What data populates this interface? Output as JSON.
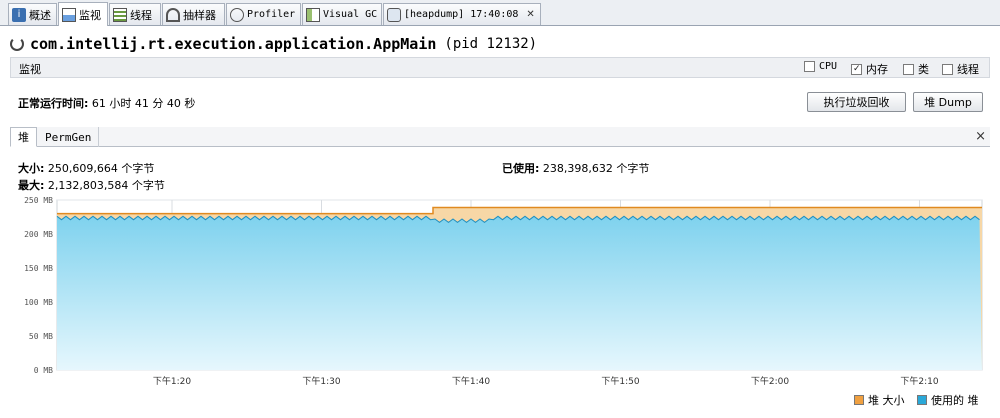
{
  "tabs": [
    {
      "label": "概述"
    },
    {
      "label": "监视"
    },
    {
      "label": "线程"
    },
    {
      "label": "抽样器"
    },
    {
      "label": "Profiler"
    },
    {
      "label": "Visual GC"
    },
    {
      "label": "[heapdump] 17:40:08"
    }
  ],
  "tab_close": "✕",
  "app": {
    "title": "com.intellij.rt.execution.application.AppMain",
    "pid": "(pid 12132)"
  },
  "section": {
    "label": "监视",
    "checkboxes": [
      {
        "label": "CPU",
        "checked": false
      },
      {
        "label": "内存",
        "checked": true
      },
      {
        "label": "类",
        "checked": false
      },
      {
        "label": "线程",
        "checked": false
      }
    ]
  },
  "uptime": {
    "label": "正常运行时间:",
    "value": "61 小时 41 分 40 秒"
  },
  "buttons": {
    "gc": "执行垃圾回收",
    "dump": "堆 Dump"
  },
  "subtabs": {
    "heap": "堆",
    "permgen": "PermGen",
    "close": "×"
  },
  "stats": {
    "size_label": "大小:",
    "size_value": "250,609,664 个字节",
    "max_label": "最大:",
    "max_value": "2,132,803,584 个字节",
    "used_label": "已使用:",
    "used_value": "238,398,632 个字节"
  },
  "chart_data": {
    "type": "area",
    "y_ticks": [
      "0 MB",
      "50 MB",
      "100 MB",
      "150 MB",
      "200 MB",
      "250 MB"
    ],
    "ylim": [
      0,
      250
    ],
    "x_ticks": [
      "下午1:20",
      "下午1:30",
      "下午1:40",
      "下午1:50",
      "下午2:00",
      "下午2:10"
    ],
    "series": [
      {
        "name": "堆 大小",
        "color": "#f0a040",
        "values_mb": [
          {
            "x": "下午1:12",
            "y": 230
          },
          {
            "x": "下午1:37",
            "y": 230
          },
          {
            "x": "下午1:37",
            "y": 239
          },
          {
            "x": "下午2:14",
            "y": 239
          }
        ]
      },
      {
        "name": "使用的 堆",
        "color": "#2aa8d8",
        "values_mb_range": [
          220,
          230
        ]
      }
    ],
    "grid": true,
    "legend": "bottom-right"
  },
  "colors": {
    "accent_orange": "#f0a040",
    "used_blue": "#2aa8d8"
  }
}
